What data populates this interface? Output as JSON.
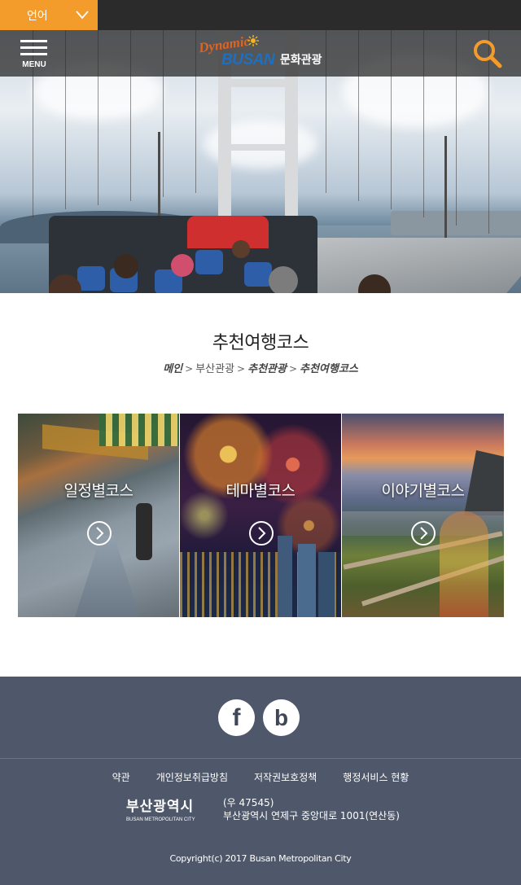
{
  "language_bar": {
    "label": "언어"
  },
  "header": {
    "menu_label": "MENU",
    "logo": {
      "dynamic": "Dynamic",
      "busan": "BUSAN",
      "suffix": "문화관광"
    }
  },
  "page": {
    "title": "추천여행코스",
    "breadcrumb": [
      "메인",
      "부산관광",
      "추천관광",
      "추천여행코스"
    ]
  },
  "cards": [
    {
      "title": "일정별코스"
    },
    {
      "title": "테마별코스"
    },
    {
      "title": "이야기별코스"
    }
  ],
  "footer": {
    "social": [
      "facebook-icon",
      "blog-icon"
    ],
    "links": [
      "약관",
      "개인정보취급방침",
      "저작권보호정책",
      "행정서비스 현황"
    ],
    "city_logo": {
      "ko": "부산광역시",
      "en": "BUSAN METROPOLITAN CITY"
    },
    "address_line1": "(우 47545)",
    "address_line2": "부산광역시 연제구 중앙대로 1001(연산동)",
    "copyright": "Copyright(c) 2017 Busan Metropolitan City"
  },
  "colors": {
    "accent": "#f39c2b",
    "footer_bg": "#4f586a",
    "logo_blue": "#1e6fc0",
    "logo_orange": "#e0641f"
  }
}
